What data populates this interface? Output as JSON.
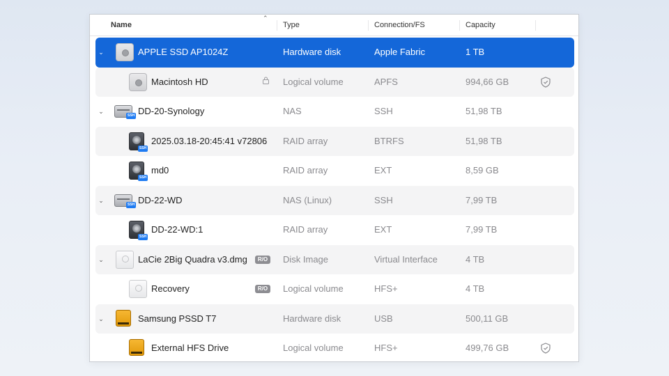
{
  "header": {
    "name": "Name",
    "type": "Type",
    "connection": "Connection/FS",
    "capacity": "Capacity"
  },
  "rows": [
    {
      "name": "APPLE SSD AP1024Z",
      "type": "Hardware disk",
      "connection": "Apple Fabric",
      "capacity": "1 TB",
      "icon": "internal-disk-icon"
    },
    {
      "name": "Macintosh HD",
      "type": "Logical volume",
      "connection": "APFS",
      "capacity": "994,66 GB",
      "icon": "volume-icon"
    },
    {
      "name": "DD-20-Synology",
      "type": "NAS",
      "connection": "SSH",
      "capacity": "51,98 TB",
      "icon": "nas-icon"
    },
    {
      "name": "2025.03.18-20:45:41 v72806",
      "type": "RAID array",
      "connection": "BTRFS",
      "capacity": "51,98 TB",
      "icon": "raid-icon"
    },
    {
      "name": "md0",
      "type": "RAID array",
      "connection": "EXT",
      "capacity": "8,59 GB",
      "icon": "raid-icon"
    },
    {
      "name": "DD-22-WD",
      "type": "NAS (Linux)",
      "connection": "SSH",
      "capacity": "7,99 TB",
      "icon": "nas-icon"
    },
    {
      "name": "DD-22-WD:1",
      "type": "RAID array",
      "connection": "EXT",
      "capacity": "7,99 TB",
      "icon": "raid-icon"
    },
    {
      "name": "LaCie 2Big Quadra v3.dmg",
      "type": "Disk Image",
      "connection": "Virtual Interface",
      "capacity": "4 TB",
      "icon": "disk-image-icon"
    },
    {
      "name": "Recovery",
      "type": "Logical volume",
      "connection": "HFS+",
      "capacity": "4 TB",
      "icon": "volume-icon"
    },
    {
      "name": "Samsung PSSD T7",
      "type": "Hardware disk",
      "connection": "USB",
      "capacity": "500,11 GB",
      "icon": "external-disk-icon"
    },
    {
      "name": "External HFS Drive",
      "type": "Logical volume",
      "connection": "HFS+",
      "capacity": "499,76 GB",
      "icon": "external-volume-icon"
    }
  ],
  "badges": {
    "read_only": "R/O",
    "ssh": "SSH"
  },
  "colors": {
    "selection": "#1467d9",
    "stripe": "#f4f4f5",
    "ssh_badge": "#1e7bf2",
    "external_disk": "#f0a81c"
  }
}
